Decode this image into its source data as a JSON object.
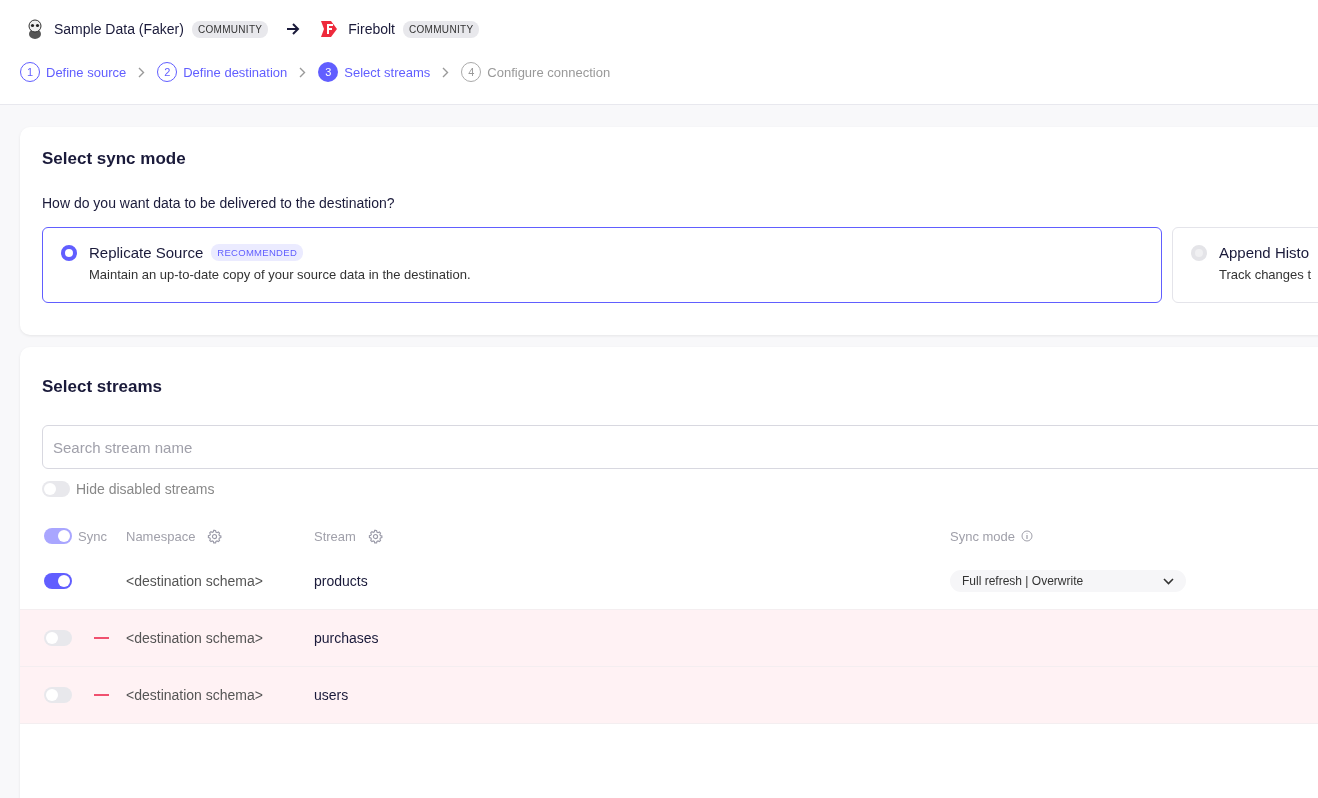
{
  "header": {
    "source": {
      "name": "Sample Data (Faker)",
      "badge": "COMMUNITY"
    },
    "destination": {
      "name": "Firebolt",
      "badge": "COMMUNITY"
    }
  },
  "steps": [
    {
      "number": "1",
      "label": "Define source",
      "completed": true,
      "selected": false
    },
    {
      "number": "2",
      "label": "Define destination",
      "completed": true,
      "selected": false
    },
    {
      "number": "3",
      "label": "Select streams",
      "completed": false,
      "selected": true
    },
    {
      "number": "4",
      "label": "Configure connection",
      "completed": false,
      "selected": false
    }
  ],
  "sync_mode_card": {
    "title": "Select sync mode",
    "question": "How do you want data to be delivered to the destination?",
    "options": [
      {
        "title": "Replicate Source",
        "badge": "RECOMMENDED",
        "description": "Maintain an up-to-date copy of your source data in the destination.",
        "selected": true
      },
      {
        "title": "Append Histo",
        "description": "Track changes t",
        "selected": false
      }
    ]
  },
  "streams_card": {
    "title": "Select streams",
    "search": {
      "placeholder": "Search stream name"
    },
    "hide_disabled": {
      "label": "Hide disabled streams",
      "on": false
    },
    "columns": {
      "sync": "Sync",
      "namespace": "Namespace",
      "stream": "Stream",
      "sync_mode": "Sync mode"
    },
    "all_sync": {
      "on": true,
      "partial": true
    },
    "rows": [
      {
        "on": true,
        "removed": false,
        "namespace": "<destination schema>",
        "stream": "products",
        "sync_mode": "Full refresh | Overwrite"
      },
      {
        "on": false,
        "removed": true,
        "namespace": "<destination schema>",
        "stream": "purchases"
      },
      {
        "on": false,
        "removed": true,
        "namespace": "<destination schema>",
        "stream": "users"
      }
    ]
  }
}
